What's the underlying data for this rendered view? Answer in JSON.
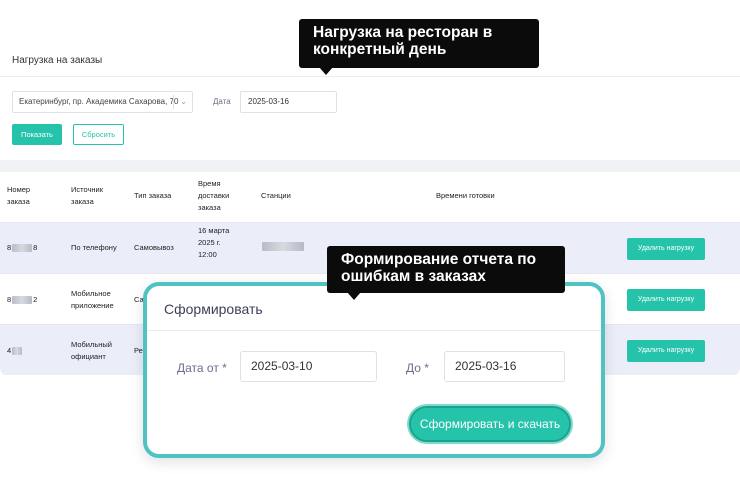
{
  "page": {
    "title": "Нагрузка на заказы"
  },
  "filters": {
    "restaurant_value": "Екатеринбург, пр. Академика Сахарова, 70",
    "date_label": "Дата",
    "date_value": "2025-03-16",
    "show_button": "Показать",
    "reset_button": "Сбросить"
  },
  "table": {
    "columns": [
      "Номер\nзаказа",
      "Источник\nзаказа",
      "Тип заказа",
      "Время\nдоставки\nзаказа",
      "Станции",
      "Времени готовки"
    ],
    "rows": [
      {
        "number": "8 8",
        "source": "По телефону",
        "type": "Самовывоз",
        "delivery": "16 марта\n2025 г.\n12:00",
        "action": "Удалить нагрузку"
      },
      {
        "number": "8 2",
        "source": "Мобильное\nприложение",
        "type": "Са",
        "delivery": "",
        "action": "Удалить нагрузку"
      },
      {
        "number": "4",
        "source": "Мобильный\nофициант",
        "type": "Ре",
        "delivery": "",
        "action": "Удалить нагрузку"
      }
    ]
  },
  "callouts": {
    "top": "Нагрузка на ресторан в\nконкретный день",
    "bottom": "Формирование отчета по\nошибкам в заказах"
  },
  "modal": {
    "title": "Сформировать",
    "from_label": "Дата от *",
    "from_value": "2025-03-10",
    "to_label": "До *",
    "to_value": "2025-03-16",
    "submit": "Сформировать и скачать"
  },
  "colors": {
    "accent": "#26c3ab",
    "modal_border": "#4fc3c3",
    "row_shade": "#ebedf8",
    "callout_bg": "#0b0b0b"
  }
}
